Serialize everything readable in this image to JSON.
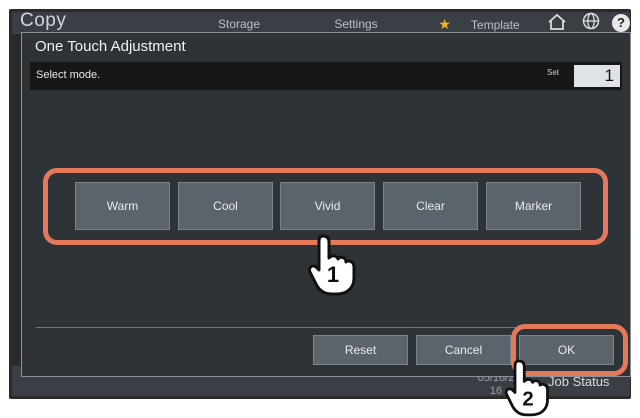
{
  "app": {
    "title": "Copy",
    "tabs": [
      "Storage",
      "Settings",
      "Template"
    ]
  },
  "icons": {
    "home": "home-icon",
    "globe": "globe-icon",
    "help": "help-icon",
    "star": "star-icon"
  },
  "background": {
    "date_partial": "05/16/2",
    "time_partial": "16",
    "job_status": "Job Status"
  },
  "dialog": {
    "title": "One Touch Adjustment",
    "prompt": "Select mode.",
    "set_label": "Set",
    "set_value": "1",
    "modes": [
      "Warm",
      "Cool",
      "Vivid",
      "Clear",
      "Marker"
    ],
    "actions": {
      "reset": "Reset",
      "cancel": "Cancel",
      "ok": "OK"
    }
  },
  "annotations": {
    "step1": "1",
    "step2": "2",
    "highlight_color": "#e6785a"
  }
}
